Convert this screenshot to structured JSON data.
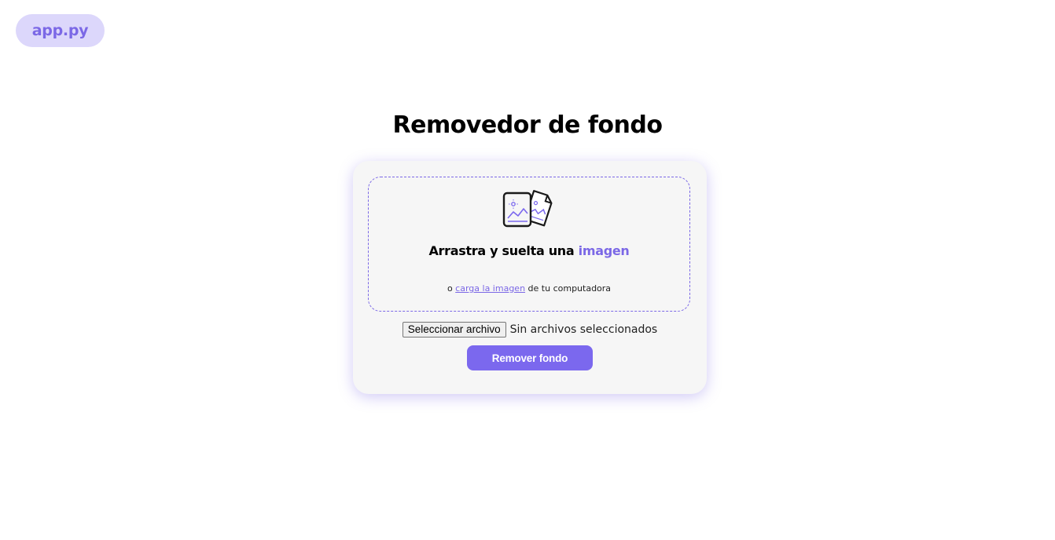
{
  "header": {
    "logo_text": "app.py"
  },
  "main": {
    "title": "Removedor de fondo"
  },
  "dropzone": {
    "icon": "images-icon",
    "heading_prefix": "Arrastra y suelta una ",
    "heading_accent": "imagen",
    "sub_prefix": "o ",
    "sub_link": "carga la imagen",
    "sub_suffix": " de tu computadora"
  },
  "file_input": {
    "button_label": "Seleccionar archivo",
    "status": "Sin archivos seleccionados"
  },
  "actions": {
    "submit_label": "Remover fondo"
  },
  "colors": {
    "accent": "#7b68ee",
    "logo_bg": "#dcd7fb",
    "card_bg": "#f6f6f6"
  }
}
